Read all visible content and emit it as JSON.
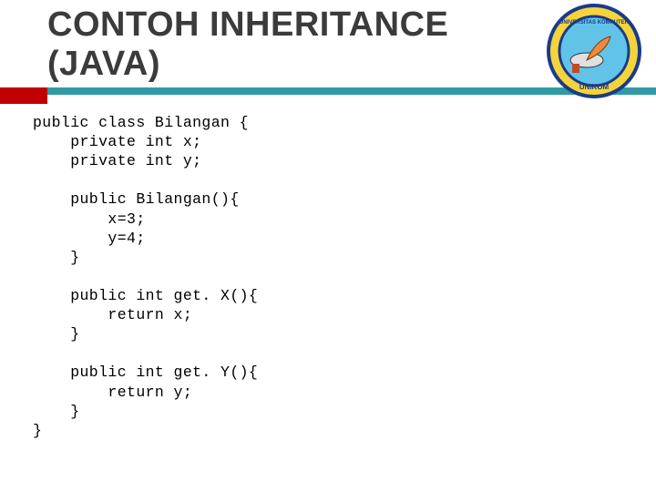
{
  "title_line1": "CONTOH INHERITANCE",
  "title_line2": "(JAVA)",
  "code_text": "public class Bilangan {\n    private int x;\n    private int y;\n\n    public Bilangan(){\n        x=3;\n        y=4;\n    }\n\n    public int get. X(){\n        return x;\n    }\n\n    public int get. Y(){\n        return y;\n    }\n}",
  "logo_label": "UNIKOM"
}
